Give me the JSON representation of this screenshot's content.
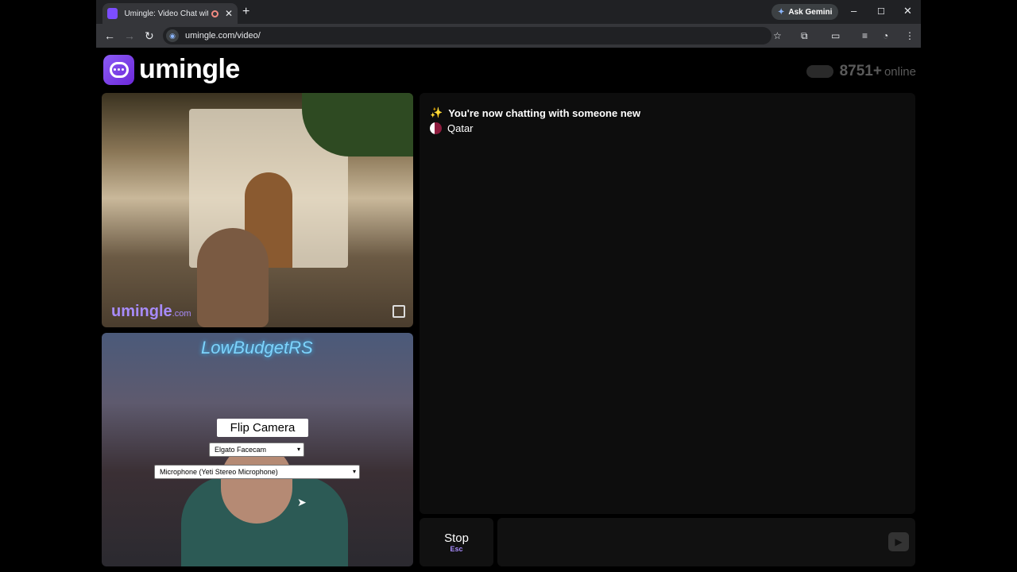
{
  "browser": {
    "tab_title": "Umingle: Video Chat with S",
    "new_tab_label": "+",
    "gemini_label": "Ask Gemini",
    "url": "umingle.com/video/",
    "win_minimize": "–",
    "win_maximize": "☐",
    "win_close": "✕"
  },
  "header": {
    "logo_text": "umingle",
    "online_count": "8751+",
    "online_label": "online"
  },
  "stranger_video": {
    "watermark": "umingle",
    "watermark_suffix": ".com"
  },
  "self_video": {
    "neon_sign": "LowBudgetRS",
    "flip_camera_label": "Flip Camera",
    "camera_select_value": "Elgato Facecam",
    "mic_select_value": "Microphone (Yeti Stereo Microphone)"
  },
  "chat": {
    "status_message": "You're now chatting with someone new",
    "country": "Qatar"
  },
  "controls": {
    "stop_label": "Stop",
    "stop_shortcut": "Esc",
    "send_label": "▶"
  },
  "colors": {
    "brand": "#7c3aed",
    "accent_text": "#a78bfa"
  }
}
